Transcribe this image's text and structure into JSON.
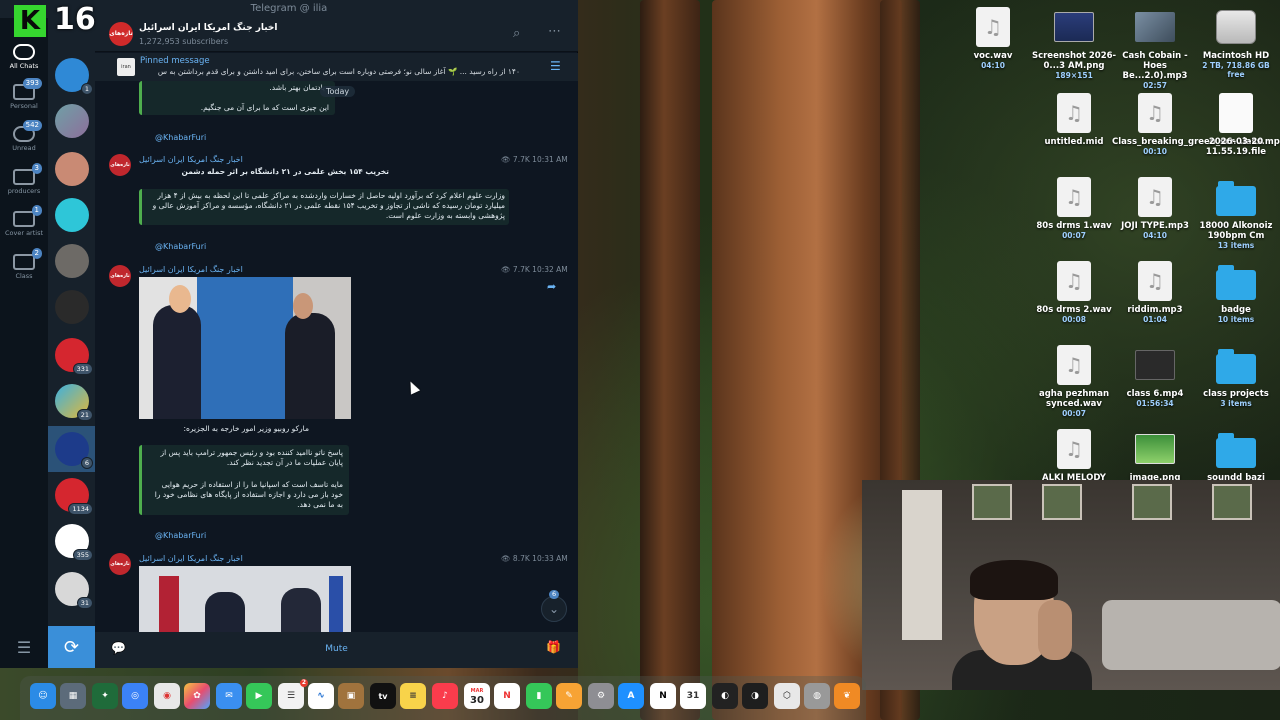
{
  "overlay": {
    "letter": "K",
    "number": "16"
  },
  "window": {
    "title": "Telegram @ ilia"
  },
  "folders": [
    {
      "label": "All Chats",
      "badge": ""
    },
    {
      "label": "Personal",
      "badge": "393"
    },
    {
      "label": "Unread",
      "badge": "542"
    },
    {
      "label": "producers",
      "badge": "3"
    },
    {
      "label": "Cover artist",
      "badge": "1"
    },
    {
      "label": "Class",
      "badge": "2"
    }
  ],
  "chatlist_badges": [
    "1",
    "331",
    "21",
    "6",
    "1134",
    "355",
    "31"
  ],
  "channel": {
    "title": "اخبار جنگ امریکا ایران اسرائیل",
    "subscribers": "1,272,953 subscribers",
    "avatar_text": "تازه‌های"
  },
  "pinned": {
    "label": "Pinned message",
    "text": "۱۴۰ از راه رسید ... 🌱 آغاز سالی نو؛ فرصتی دوباره است برای ساختن، برای امید داشتن و برای قدم برداشتن به س"
  },
  "messages": {
    "prev_tail_1": "یادتمان بهتر باشد.",
    "prev_tail_2": "این چیزی است که ما برای آن می جنگیم.",
    "day_label": "Today",
    "signature": "@KhabarFuri",
    "m1": {
      "sender": "اخبار جنگ امریکا ایران اسرائیل",
      "views": "7.7K",
      "time": "10:31 AM",
      "headline": "تخریب ۱۵۴ بخش علمی در ۲۱ دانشگاه بر اثر حمله دشمن",
      "quote": "وزارت علوم اعلام کرد که برآورد اولیه حاصل از خسارات واردشده به مراکز علمی تا این لحظه به بیش از ۴ هزار میلیارد تومان رسیده که ناشی از تجاوز و تخریب ۱۵۴ نقطه علمی در ۲۱ دانشگاه، مؤسسه و مراکز آموزش عالی و پژوهشی وابسته به وزارت علوم است."
    },
    "m2": {
      "sender": "اخبار جنگ امریکا ایران اسرائیل",
      "views": "7.7K",
      "time": "10:32 AM",
      "caption": "مارکو روبیو وزیر امور خارجه به الجزیره:",
      "quote_1": "پاسخ ناتو ناامید کننده بود و رئیس جمهور ترامپ باید پس از پایان عملیات ما در آن تجدید نظر کند.",
      "quote_2": "مایه تاسف است که اسپانیا ما را از استفاده از حریم هوایی خود باز می دارد و اجازه استفاده از پایگاه های نظامی خود را به ما نمی دهد."
    },
    "m3": {
      "sender": "اخبار جنگ امریکا ایران اسرائیل",
      "views": "8.7K",
      "time": "10:33 AM"
    },
    "scroll_badge": "6"
  },
  "bottom": {
    "mute_label": "Mute"
  },
  "desktop_icons": [
    {
      "name": "voc.wav",
      "meta": "04:10"
    },
    {
      "name": "Screenshot 2026-0...3 AM.png",
      "meta": "189×151"
    },
    {
      "name": "Cash Cobain - Hoes Be...2.0).mp3",
      "meta": "02:57"
    },
    {
      "name": "Macintosh HD",
      "meta": "2 TB, 718.86 GB free"
    },
    {
      "name": "untitled.mid",
      "meta": ""
    },
    {
      "name": "Class_breaking_green_scr...lass.mp3",
      "meta": "00:10"
    },
    {
      "name": "2026-03-20 11.55.19.file",
      "meta": ""
    },
    {
      "name": "80s drms 1.wav",
      "meta": "00:07"
    },
    {
      "name": "JOJI TYPE.mp3",
      "meta": "04:10"
    },
    {
      "name": "18000 Alkonoiz 190bpm Cm",
      "meta": "13 items"
    },
    {
      "name": "80s drms 2.wav",
      "meta": "00:08"
    },
    {
      "name": "riddim.mp3",
      "meta": "01:04"
    },
    {
      "name": "badge",
      "meta": "10 items"
    },
    {
      "name": "agha pezhman synced.wav",
      "meta": "00:07"
    },
    {
      "name": "class 6.mp4",
      "meta": "01:56:34"
    },
    {
      "name": "class projects",
      "meta": "3 items"
    },
    {
      "name": "ALKI MELODY",
      "meta": ""
    },
    {
      "name": "image.png",
      "meta": ""
    },
    {
      "name": "soundd bazi",
      "meta": ""
    }
  ],
  "dock": {
    "calendar_month": "MAR",
    "calendar_day": "30",
    "tv_label": "tv",
    "messages_badge": "2"
  }
}
